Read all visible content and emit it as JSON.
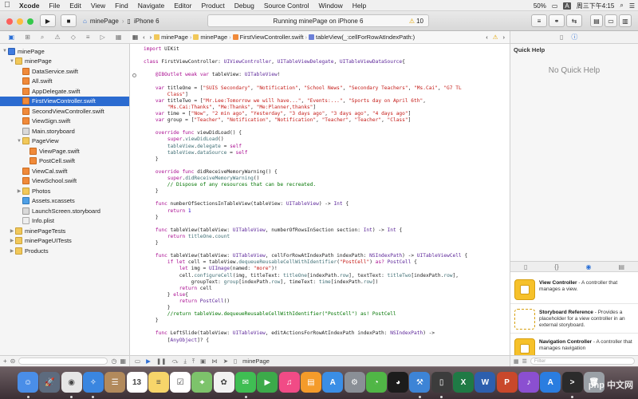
{
  "menubar": {
    "app": "Xcode",
    "items": [
      "File",
      "Edit",
      "View",
      "Find",
      "Navigate",
      "Editor",
      "Product",
      "Debug",
      "Source Control",
      "Window",
      "Help"
    ],
    "battery": "50%",
    "clock": "周三下午4:15"
  },
  "toolbar": {
    "scheme_project": "minePage",
    "scheme_device": "iPhone 6",
    "status": "Running minePage on iPhone 6",
    "warnings": "10"
  },
  "navigator": {
    "filter_placeholder": "",
    "rows": [
      {
        "label": "minePage",
        "level": 0,
        "icon": "proj",
        "tri": "▼",
        "sel": false
      },
      {
        "label": "minePage",
        "level": 1,
        "icon": "folder",
        "tri": "▼",
        "sel": false
      },
      {
        "label": "DataService.swift",
        "level": 2,
        "icon": "swift",
        "tri": "",
        "sel": false
      },
      {
        "label": "All.swift",
        "level": 2,
        "icon": "swift",
        "tri": "",
        "sel": false
      },
      {
        "label": "AppDelegate.swift",
        "level": 2,
        "icon": "swift",
        "tri": "",
        "sel": false
      },
      {
        "label": "FirstViewController.swift",
        "level": 2,
        "icon": "swift",
        "tri": "",
        "sel": true
      },
      {
        "label": "SecondViewController.swift",
        "level": 2,
        "icon": "swift",
        "tri": "",
        "sel": false
      },
      {
        "label": "ViewSign.swift",
        "level": 2,
        "icon": "swift",
        "tri": "",
        "sel": false
      },
      {
        "label": "Main.storyboard",
        "level": 2,
        "icon": "sb",
        "tri": "",
        "sel": false
      },
      {
        "label": "PageView",
        "level": 2,
        "icon": "folder",
        "tri": "▼",
        "sel": false
      },
      {
        "label": "ViewPage.swift",
        "level": 3,
        "icon": "swift",
        "tri": "",
        "sel": false
      },
      {
        "label": "PostCell.swift",
        "level": 3,
        "icon": "swift",
        "tri": "",
        "sel": false
      },
      {
        "label": "ViewCal.swift",
        "level": 2,
        "icon": "swift",
        "tri": "",
        "sel": false
      },
      {
        "label": "ViewSchool.swift",
        "level": 2,
        "icon": "swift",
        "tri": "",
        "sel": false
      },
      {
        "label": "Photos",
        "level": 2,
        "icon": "folder",
        "tri": "▶",
        "sel": false
      },
      {
        "label": "Assets.xcassets",
        "level": 2,
        "icon": "asset",
        "tri": "",
        "sel": false
      },
      {
        "label": "LaunchScreen.storyboard",
        "level": 2,
        "icon": "sb",
        "tri": "",
        "sel": false
      },
      {
        "label": "Info.plist",
        "level": 2,
        "icon": "plist",
        "tri": "",
        "sel": false
      },
      {
        "label": "minePageTests",
        "level": 1,
        "icon": "folder",
        "tri": "▶",
        "sel": false
      },
      {
        "label": "minePageUITests",
        "level": 1,
        "icon": "folder",
        "tri": "▶",
        "sel": false
      },
      {
        "label": "Products",
        "level": 1,
        "icon": "folder",
        "tri": "▶",
        "sel": false
      }
    ]
  },
  "jumpbar": {
    "crumbs": [
      "minePage",
      "minePage",
      "FirstViewController.swift",
      "tableView(_:cellForRowAtIndexPath:)"
    ]
  },
  "code": [
    [
      [
        "kw",
        "import"
      ],
      [
        "pl",
        " UIKit"
      ]
    ],
    [],
    [
      [
        "kw",
        "class"
      ],
      [
        "pl",
        " FirstViewController: "
      ],
      [
        "ty",
        "UIViewController"
      ],
      [
        "pl",
        ", "
      ],
      [
        "ty",
        "UITableViewDelegate"
      ],
      [
        "pl",
        ", "
      ],
      [
        "ty",
        "UITableViewDataSource"
      ],
      [
        "pl",
        "{"
      ]
    ],
    [],
    [
      [
        "pl",
        "    "
      ],
      [
        "kw",
        "@IBOutlet"
      ],
      [
        "pl",
        " "
      ],
      [
        "kw",
        "weak"
      ],
      [
        "pl",
        " "
      ],
      [
        "kw",
        "var"
      ],
      [
        "pl",
        " tableView: "
      ],
      [
        "ty",
        "UITableView"
      ],
      [
        "pl",
        "!"
      ]
    ],
    [],
    [
      [
        "pl",
        "    "
      ],
      [
        "kw",
        "var"
      ],
      [
        "pl",
        " titleOne = ["
      ],
      [
        "st",
        "\"SUIS Secondary\""
      ],
      [
        "pl",
        ", "
      ],
      [
        "st",
        "\"Notification\""
      ],
      [
        "pl",
        ", "
      ],
      [
        "st",
        "\"School News\""
      ],
      [
        "pl",
        ", "
      ],
      [
        "st",
        "\"Secondary Teachers\""
      ],
      [
        "pl",
        ", "
      ],
      [
        "st",
        "\"Ms.Cai\""
      ],
      [
        "pl",
        ", "
      ],
      [
        "st",
        "\"G7 TL"
      ]
    ],
    [
      [
        "st",
        "        Class\""
      ],
      [
        "pl",
        "]"
      ]
    ],
    [
      [
        "pl",
        "    "
      ],
      [
        "kw",
        "var"
      ],
      [
        "pl",
        " titleTwo = ["
      ],
      [
        "st",
        "\"Mr.Lee:Tomorrow we will have...\""
      ],
      [
        "pl",
        ", "
      ],
      [
        "st",
        "\"Events:...\""
      ],
      [
        "pl",
        ", "
      ],
      [
        "st",
        "\"Sports day on April 6th\""
      ],
      [
        "pl",
        ","
      ]
    ],
    [
      [
        "pl",
        "        "
      ],
      [
        "st",
        "\"Ms.Cai:Thanks\""
      ],
      [
        "pl",
        ", "
      ],
      [
        "st",
        "\"Me:Thanks\""
      ],
      [
        "pl",
        ", "
      ],
      [
        "st",
        "\"Me:Planner,thanks\""
      ],
      [
        "pl",
        "]"
      ]
    ],
    [
      [
        "pl",
        "    "
      ],
      [
        "kw",
        "var"
      ],
      [
        "pl",
        " time = ["
      ],
      [
        "st",
        "\"Now\""
      ],
      [
        "pl",
        ", "
      ],
      [
        "st",
        "\"2 min ago\""
      ],
      [
        "pl",
        ", "
      ],
      [
        "st",
        "\"Yesterday\""
      ],
      [
        "pl",
        ", "
      ],
      [
        "st",
        "\"3 days ago\""
      ],
      [
        "pl",
        ", "
      ],
      [
        "st",
        "\"3 days ago\""
      ],
      [
        "pl",
        ", "
      ],
      [
        "st",
        "\"4 days ago\""
      ],
      [
        "pl",
        "]"
      ]
    ],
    [
      [
        "pl",
        "    "
      ],
      [
        "kw",
        "var"
      ],
      [
        "pl",
        " group = ["
      ],
      [
        "st",
        "\"Teacher\""
      ],
      [
        "pl",
        ", "
      ],
      [
        "st",
        "\"Notification\""
      ],
      [
        "pl",
        ", "
      ],
      [
        "st",
        "\"Notification\""
      ],
      [
        "pl",
        ", "
      ],
      [
        "st",
        "\"Teacher\""
      ],
      [
        "pl",
        ", "
      ],
      [
        "st",
        "\"Teacher\""
      ],
      [
        "pl",
        ", "
      ],
      [
        "st",
        "\"Class\""
      ],
      [
        "pl",
        "]"
      ]
    ],
    [],
    [
      [
        "pl",
        "    "
      ],
      [
        "kw",
        "override"
      ],
      [
        "pl",
        " "
      ],
      [
        "kw",
        "func"
      ],
      [
        "pl",
        " viewDidLoad() {"
      ]
    ],
    [
      [
        "pl",
        "        "
      ],
      [
        "kw",
        "super"
      ],
      [
        "pl",
        "."
      ],
      [
        "fn",
        "viewDidLoad"
      ],
      [
        "pl",
        "()"
      ]
    ],
    [
      [
        "pl",
        "        "
      ],
      [
        "fn",
        "tableView"
      ],
      [
        "pl",
        "."
      ],
      [
        "fn",
        "delegate"
      ],
      [
        "pl",
        " = "
      ],
      [
        "kw",
        "self"
      ]
    ],
    [
      [
        "pl",
        "        "
      ],
      [
        "fn",
        "tableView"
      ],
      [
        "pl",
        "."
      ],
      [
        "fn",
        "dataSource"
      ],
      [
        "pl",
        " = "
      ],
      [
        "kw",
        "self"
      ]
    ],
    [
      [
        "pl",
        "    }"
      ]
    ],
    [],
    [
      [
        "pl",
        "    "
      ],
      [
        "kw",
        "override"
      ],
      [
        "pl",
        " "
      ],
      [
        "kw",
        "func"
      ],
      [
        "pl",
        " didReceiveMemoryWarning() {"
      ]
    ],
    [
      [
        "pl",
        "        "
      ],
      [
        "kw",
        "super"
      ],
      [
        "pl",
        "."
      ],
      [
        "fn",
        "didReceiveMemoryWarning"
      ],
      [
        "pl",
        "()"
      ]
    ],
    [
      [
        "cm",
        "        // Dispose of any resources that can be recreated."
      ]
    ],
    [
      [
        "pl",
        "    }"
      ]
    ],
    [],
    [
      [
        "pl",
        "    "
      ],
      [
        "kw",
        "func"
      ],
      [
        "pl",
        " numberOfSectionsInTableView(tableView: "
      ],
      [
        "ty",
        "UITableView"
      ],
      [
        "pl",
        ") -> "
      ],
      [
        "ty",
        "Int"
      ],
      [
        "pl",
        " {"
      ]
    ],
    [
      [
        "pl",
        "        "
      ],
      [
        "kw",
        "return"
      ],
      [
        "pl",
        " "
      ],
      [
        "nu",
        "1"
      ]
    ],
    [
      [
        "pl",
        "    }"
      ]
    ],
    [],
    [
      [
        "pl",
        "    "
      ],
      [
        "kw",
        "func"
      ],
      [
        "pl",
        " tableView(tableView: "
      ],
      [
        "ty",
        "UITableView"
      ],
      [
        "pl",
        ", numberOfRowsInSection section: "
      ],
      [
        "ty",
        "Int"
      ],
      [
        "pl",
        ") -> "
      ],
      [
        "ty",
        "Int"
      ],
      [
        "pl",
        " {"
      ]
    ],
    [
      [
        "pl",
        "        "
      ],
      [
        "kw",
        "return"
      ],
      [
        "pl",
        " "
      ],
      [
        "fn",
        "titleOne"
      ],
      [
        "pl",
        "."
      ],
      [
        "fn",
        "count"
      ]
    ],
    [
      [
        "pl",
        "    }"
      ]
    ],
    [],
    [
      [
        "pl",
        "    "
      ],
      [
        "kw",
        "func"
      ],
      [
        "pl",
        " tableView(tableView: "
      ],
      [
        "ty",
        "UITableView"
      ],
      [
        "pl",
        ", cellForRowAtIndexPath indexPath: "
      ],
      [
        "ty",
        "NSIndexPath"
      ],
      [
        "pl",
        ") -> "
      ],
      [
        "ty",
        "UITableViewCell"
      ],
      [
        "pl",
        " {"
      ]
    ],
    [
      [
        "pl",
        "        "
      ],
      [
        "kw",
        "if"
      ],
      [
        "pl",
        " "
      ],
      [
        "kw",
        "let"
      ],
      [
        "pl",
        " cell = tableView."
      ],
      [
        "fn",
        "dequeueReusableCellWithIdentifier"
      ],
      [
        "pl",
        "("
      ],
      [
        "st",
        "\"PostCell\""
      ],
      [
        "pl",
        ") "
      ],
      [
        "kw",
        "as?"
      ],
      [
        "pl",
        " "
      ],
      [
        "ty",
        "PostCell"
      ],
      [
        "pl",
        " {"
      ]
    ],
    [
      [
        "pl",
        "            "
      ],
      [
        "kw",
        "let"
      ],
      [
        "pl",
        " img = "
      ],
      [
        "ty",
        "UIImage"
      ],
      [
        "pl",
        "(named: "
      ],
      [
        "st",
        "\"more\""
      ],
      [
        "pl",
        ")!"
      ]
    ],
    [
      [
        "pl",
        "            cell."
      ],
      [
        "fn",
        "configureCell"
      ],
      [
        "pl",
        "(img, titleText: "
      ],
      [
        "fn",
        "titleOne"
      ],
      [
        "pl",
        "[indexPath."
      ],
      [
        "fn",
        "row"
      ],
      [
        "pl",
        "], textText: "
      ],
      [
        "fn",
        "titleTwo"
      ],
      [
        "pl",
        "[indexPath."
      ],
      [
        "fn",
        "row"
      ],
      [
        "pl",
        "],"
      ]
    ],
    [
      [
        "pl",
        "                groupText: "
      ],
      [
        "fn",
        "group"
      ],
      [
        "pl",
        "[indexPath."
      ],
      [
        "fn",
        "row"
      ],
      [
        "pl",
        "], timeText: "
      ],
      [
        "fn",
        "time"
      ],
      [
        "pl",
        "[indexPath."
      ],
      [
        "fn",
        "row"
      ],
      [
        "pl",
        "])"
      ]
    ],
    [
      [
        "pl",
        "            "
      ],
      [
        "kw",
        "return"
      ],
      [
        "pl",
        " cell"
      ]
    ],
    [
      [
        "pl",
        "        } "
      ],
      [
        "kw",
        "else"
      ],
      [
        "pl",
        "{"
      ]
    ],
    [
      [
        "pl",
        "            "
      ],
      [
        "kw",
        "return"
      ],
      [
        "pl",
        " "
      ],
      [
        "ty",
        "PostCell"
      ],
      [
        "pl",
        "()"
      ]
    ],
    [
      [
        "pl",
        "        }"
      ]
    ],
    [
      [
        "cm",
        "        //return tableView.dequeueReusableCellWithIdentifier(\"PostCell\") as! PostCell"
      ]
    ],
    [
      [
        "pl",
        "    }"
      ]
    ],
    [],
    [
      [
        "pl",
        "    "
      ],
      [
        "kw",
        "func"
      ],
      [
        "pl",
        " LeftSlide(tableView: "
      ],
      [
        "ty",
        "UITableView"
      ],
      [
        "pl",
        ", editActionsForRowAtIndexPath indexPath: "
      ],
      [
        "ty",
        "NSIndexPath"
      ],
      [
        "pl",
        ") ->"
      ]
    ],
    [
      [
        "pl",
        "        ["
      ],
      [
        "ty",
        "AnyObject"
      ],
      [
        "pl",
        "]? {"
      ]
    ]
  ],
  "debugbar": {
    "target": "minePage"
  },
  "utilities": {
    "quick_help_title": "Quick Help",
    "no_quick_help": "No Quick Help",
    "filter_placeholder": "Filter",
    "library": [
      {
        "name": "View Controller",
        "desc": " - A controller that manages a view."
      },
      {
        "name": "Storyboard Reference",
        "desc": " - Provides a placeholder for a view controller in an external storyboard."
      },
      {
        "name": "Navigation Controller",
        "desc": " - A controller that manages navigation"
      }
    ]
  },
  "dock": {
    "apps": [
      {
        "name": "finder",
        "color": "#4a8ee8",
        "glyph": "☺"
      },
      {
        "name": "launchpad",
        "color": "#5d6b7e",
        "glyph": "🚀"
      },
      {
        "name": "chrome",
        "color": "#e6e6e6",
        "glyph": "◉"
      },
      {
        "name": "safari",
        "color": "#3a86e0",
        "glyph": "✧"
      },
      {
        "name": "contacts",
        "color": "#b28a5c",
        "glyph": "☰"
      },
      {
        "name": "calendar",
        "color": "#ffffff",
        "glyph": "13"
      },
      {
        "name": "notes",
        "color": "#f7d56a",
        "glyph": "≡"
      },
      {
        "name": "reminders",
        "color": "#ffffff",
        "glyph": "☑"
      },
      {
        "name": "maps",
        "color": "#7dc36b",
        "glyph": "⌖"
      },
      {
        "name": "photos",
        "color": "#f2f2f2",
        "glyph": "✿"
      },
      {
        "name": "messages",
        "color": "#3fbe53",
        "glyph": "✉"
      },
      {
        "name": "facetime",
        "color": "#3caa4a",
        "glyph": "▶"
      },
      {
        "name": "itunes",
        "color": "#f14b86",
        "glyph": "♫"
      },
      {
        "name": "ibooks",
        "color": "#f49b2a",
        "glyph": "▤"
      },
      {
        "name": "app-store",
        "color": "#3a8ee6",
        "glyph": "A"
      },
      {
        "name": "system-preferences",
        "color": "#8a8f96",
        "glyph": "⚙"
      },
      {
        "name": "wechat",
        "color": "#50b646",
        "glyph": "◔"
      },
      {
        "name": "qq",
        "color": "#1c1c1c",
        "glyph": "◕"
      },
      {
        "name": "xcode",
        "color": "#3d84d6",
        "glyph": "⚒"
      },
      {
        "name": "simulator",
        "color": "#3c3c3c",
        "glyph": "▯"
      },
      {
        "name": "excel",
        "color": "#1f7a45",
        "glyph": "X"
      },
      {
        "name": "word",
        "color": "#2d5fae",
        "glyph": "W"
      },
      {
        "name": "powerpoint",
        "color": "#c9482b",
        "glyph": "P"
      },
      {
        "name": "music",
        "color": "#8b4fd1",
        "glyph": "♪"
      },
      {
        "name": "app-store-2",
        "color": "#2a7de0",
        "glyph": "A"
      },
      {
        "name": "terminal",
        "color": "#2b2b2b",
        "glyph": ">"
      },
      {
        "name": "trash",
        "color": "#9aa0a6",
        "glyph": "🗑"
      }
    ],
    "watermark": "php 中文网"
  }
}
